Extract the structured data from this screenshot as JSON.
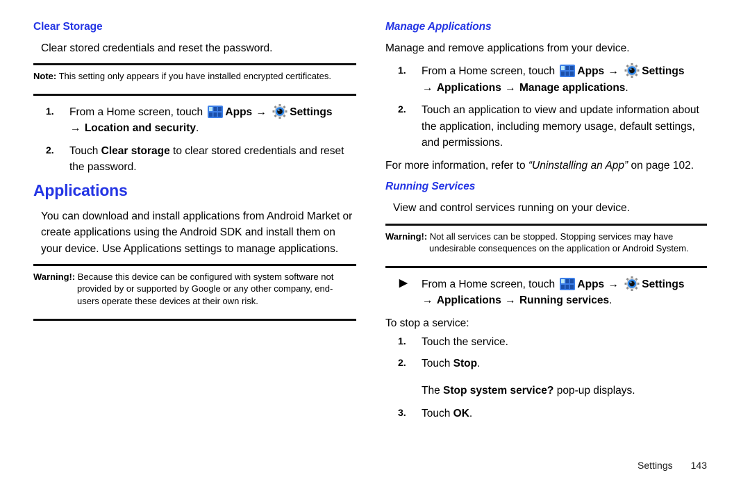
{
  "document": {
    "page_number": "143",
    "footer_section": "Settings"
  },
  "left_column": {
    "clear_storage": {
      "heading": "Clear Storage",
      "intro": "Clear stored credentials and reset the password.",
      "note": {
        "label": "Note:",
        "text": "This setting only appears if you have installed encrypted certificates."
      },
      "steps": [
        {
          "marker": "1.",
          "line1_pre": "From a Home screen, touch",
          "apps_label": "Apps",
          "settings_label": "Settings",
          "line2": "Location and security",
          "line2_period": "."
        },
        {
          "marker": "2.",
          "text_pre": "Touch ",
          "text_bold": "Clear storage",
          "text_post": " to clear stored credentials and reset the password."
        }
      ]
    },
    "applications": {
      "heading": "Applications",
      "intro": "You can download and install applications from Android Market or create applications using the Android SDK and install them on your device. Use Applications settings to manage applications.",
      "warning": {
        "label": "Warning!:",
        "text": "Because this device can be configured with system software not provided by or supported by Google or any other company, end-users operate these devices at their own risk."
      }
    }
  },
  "right_column": {
    "manage_applications": {
      "heading": "Manage Applications",
      "intro": "Manage and remove applications from your device.",
      "steps": [
        {
          "marker": "1.",
          "line1_pre": "From a Home screen, touch",
          "apps_label": "Apps",
          "settings_label": "Settings",
          "line2_a": "Applications",
          "line2_b": "Manage applications",
          "line2_period": "."
        },
        {
          "marker": "2.",
          "text": "Touch an application to view and update information about the application, including memory usage, default settings, and permissions."
        }
      ],
      "more_info_pre": "For more information, refer to ",
      "more_info_italic": "“Uninstalling an App”",
      "more_info_post": " on page 102."
    },
    "running_services": {
      "heading": "Running Services",
      "intro": "View and control services running on your device.",
      "warning": {
        "label": "Warning!:",
        "text": "Not all services can be stopped. Stopping services may have undesirable consequences on the application or Android System."
      },
      "bullet_step": {
        "marker": "▶",
        "line1_pre": "From a Home screen, touch",
        "apps_label": "Apps",
        "settings_label": "Settings",
        "line2_a": "Applications",
        "line2_b": "Running services",
        "line2_period": "."
      },
      "stop_intro": "To stop a service:",
      "stop_steps": [
        {
          "marker": "1.",
          "text": "Touch the service."
        },
        {
          "marker": "2.",
          "text_pre": "Touch ",
          "text_bold": "Stop",
          "text_post": "."
        },
        {
          "marker": "3.",
          "text_pre": "Touch ",
          "text_bold": "OK",
          "text_post": "."
        }
      ],
      "popup_note_pre": "The ",
      "popup_note_bold": "Stop system service?",
      "popup_note_post": " pop-up displays."
    }
  },
  "symbols": {
    "arrow": "→",
    "bullet_triangle": "▶"
  },
  "colors": {
    "heading_blue": "#2435E4",
    "rule_black": "#111111",
    "apps_icon_blue": "#3D7FE8",
    "gear_ring_blue": "#2E86E8"
  }
}
